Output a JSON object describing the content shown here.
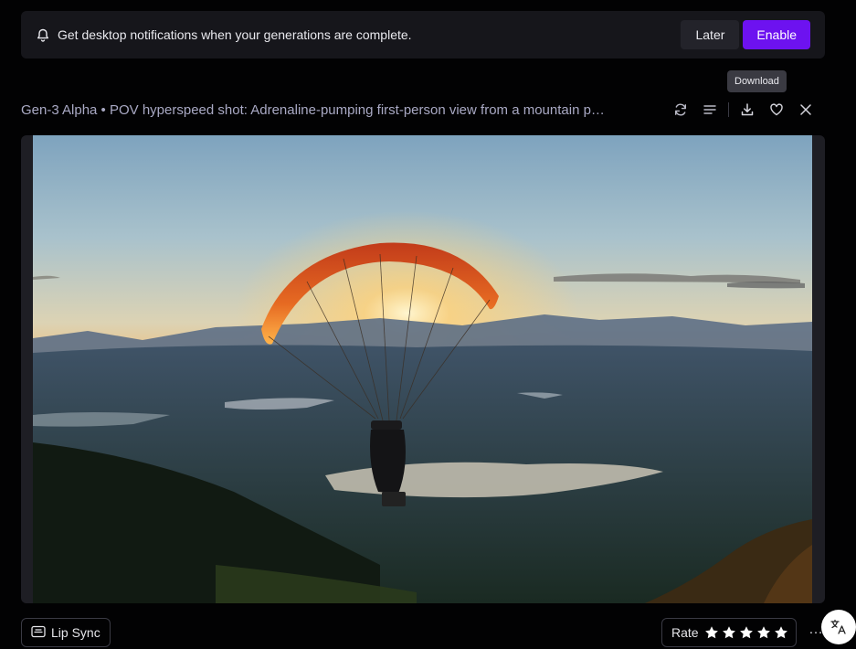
{
  "notification": {
    "message": "Get desktop notifications when your generations are complete.",
    "later_label": "Later",
    "enable_label": "Enable",
    "icon": "bell-icon"
  },
  "tooltip": {
    "text": "Download"
  },
  "generation": {
    "title": "Gen-3 Alpha • POV hyperspeed shot: Adrenaline-pumping first-person view from a mountain p…",
    "actions": [
      "refresh-icon",
      "details-icon",
      "download-icon",
      "heart-icon",
      "close-icon"
    ]
  },
  "media": {
    "description_icon": "video-frame",
    "accent_sunset": "#f4a54a",
    "accent_canopy": "#e2621d"
  },
  "footer": {
    "lip_sync_label": "Lip Sync",
    "rate_label": "Rate",
    "rating_max": 5,
    "more_label": "…"
  },
  "colors": {
    "brand_purple": "#6d12f0",
    "background": "#020203",
    "panel": "#16161b"
  }
}
